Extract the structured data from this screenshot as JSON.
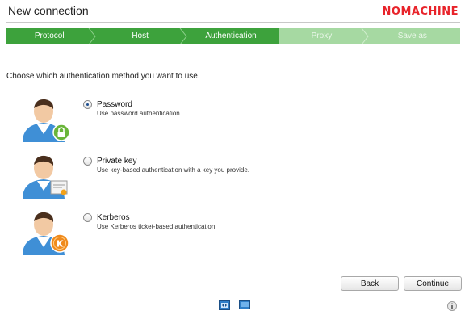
{
  "window": {
    "title": "New connection",
    "brand": "NOMACHINE"
  },
  "steps": [
    {
      "label": "Protocol",
      "state": "done"
    },
    {
      "label": "Host",
      "state": "done"
    },
    {
      "label": "Authentication",
      "state": "current"
    },
    {
      "label": "Proxy",
      "state": "pending"
    },
    {
      "label": "Save as",
      "state": "pending"
    }
  ],
  "instruction": "Choose which authentication method you want to use.",
  "options": [
    {
      "label": "Password",
      "description": "Use password authentication.",
      "selected": true,
      "icon": "user-lock-icon"
    },
    {
      "label": "Private key",
      "description": "Use key-based authentication with a key you provide.",
      "selected": false,
      "icon": "user-certificate-icon"
    },
    {
      "label": "Kerberos",
      "description": "Use Kerberos ticket-based authentication.",
      "selected": false,
      "icon": "user-kerberos-icon"
    }
  ],
  "buttons": {
    "back": "Back",
    "continue": "Continue"
  },
  "colors": {
    "step_done": "#3da23c",
    "step_pending": "#a6d9a2",
    "brand": "#e8232a"
  }
}
